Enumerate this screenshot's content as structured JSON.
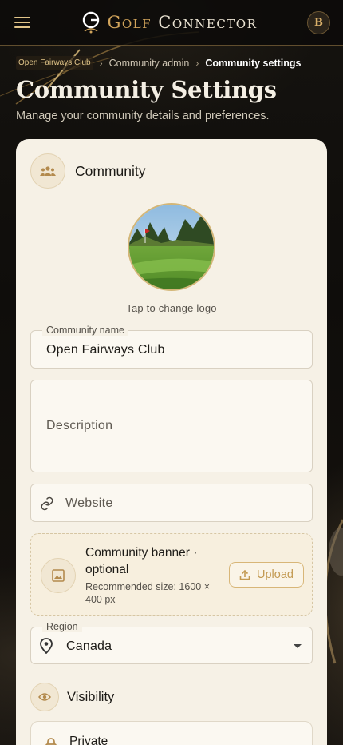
{
  "app": {
    "brand_prefix": "Golf",
    "brand_suffix": "Connector",
    "avatar_initial": "B"
  },
  "breadcrumb": {
    "items": [
      "Open Fairways Club",
      "Community admin",
      "Community settings"
    ],
    "separator": "›"
  },
  "page": {
    "title": "Community Settings",
    "subtitle": "Manage your community details and preferences."
  },
  "community_section": {
    "title": "Community",
    "logo_hint": "Tap to change logo"
  },
  "form": {
    "community_name_label": "Community name",
    "community_name_value": "Open Fairways Club",
    "description_placeholder": "Description",
    "website_placeholder": "Website",
    "banner_title": "Community banner · optional",
    "banner_hint": "Recommended size: 1600 × 400 px",
    "upload_label": "Upload",
    "region_label": "Region",
    "region_value": "Canada"
  },
  "visibility_section": {
    "title": "Visibility",
    "private_option": "Private"
  },
  "colors": {
    "accent_gold": "#d1a45b",
    "card_bg": "#f6f1e6",
    "page_bg": "#0f0d0b"
  }
}
